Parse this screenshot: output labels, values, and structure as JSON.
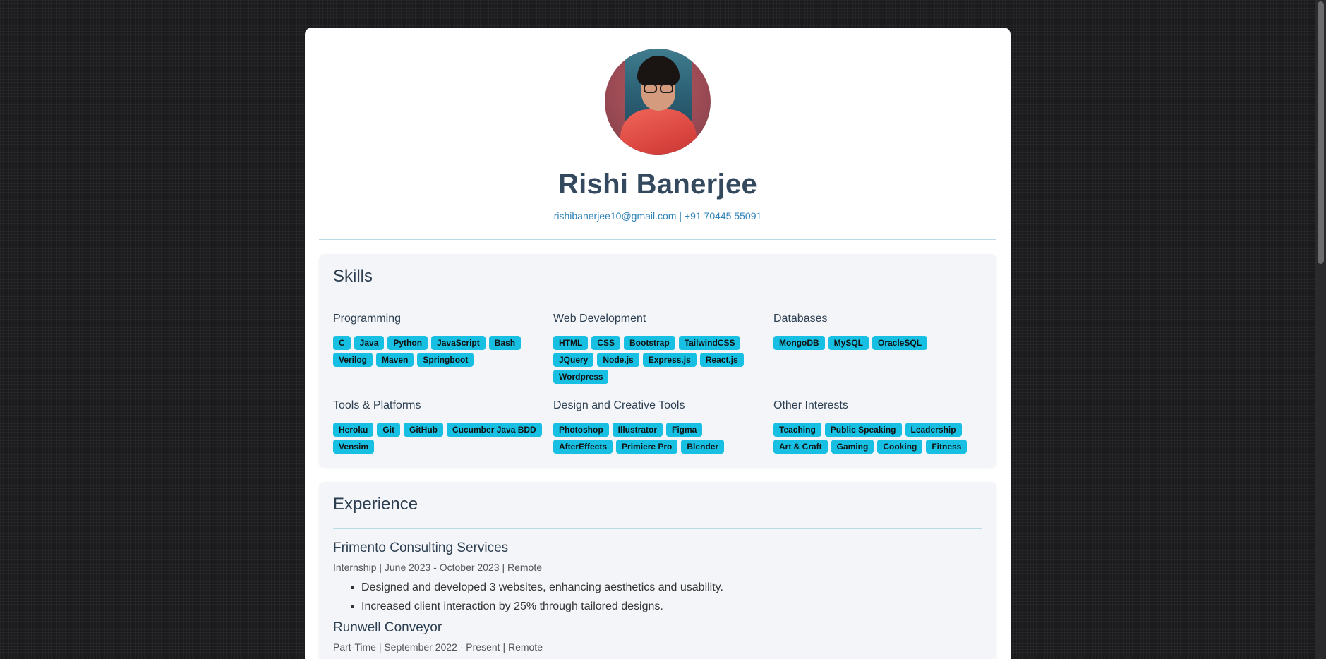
{
  "profile": {
    "name": "Rishi Banerjee",
    "email": "rishibanerjee10@gmail.com",
    "separator": "|",
    "phone": "+91 70445 55091"
  },
  "skills": {
    "heading": "Skills",
    "groups": [
      {
        "title": "Programming",
        "tags": [
          "C",
          "Java",
          "Python",
          "JavaScript",
          "Bash",
          "Verilog",
          "Maven",
          "Springboot"
        ]
      },
      {
        "title": "Web Development",
        "tags": [
          "HTML",
          "CSS",
          "Bootstrap",
          "TailwindCSS",
          "JQuery",
          "Node.js",
          "Express.js",
          "React.js",
          "Wordpress"
        ]
      },
      {
        "title": "Databases",
        "tags": [
          "MongoDB",
          "MySQL",
          "OracleSQL"
        ]
      },
      {
        "title": "Tools & Platforms",
        "tags": [
          "Heroku",
          "Git",
          "GitHub",
          "Cucumber Java BDD",
          "Vensim"
        ]
      },
      {
        "title": "Design and Creative Tools",
        "tags": [
          "Photoshop",
          "Illustrator",
          "Figma",
          "AfterEffects",
          "Primiere Pro",
          "Blender"
        ]
      },
      {
        "title": "Other Interests",
        "tags": [
          "Teaching",
          "Public Speaking",
          "Leadership",
          "Art & Craft",
          "Gaming",
          "Cooking",
          "Fitness"
        ]
      }
    ]
  },
  "experience": {
    "heading": "Experience",
    "jobs": [
      {
        "company": "Frimento Consulting Services",
        "meta": "Internship | June 2023 - October 2023 | Remote",
        "bullets": [
          "Designed and developed 3 websites, enhancing aesthetics and usability.",
          "Increased client interaction by 25% through tailored designs."
        ]
      },
      {
        "company": "Runwell Conveyor",
        "meta": "Part-Time | September 2022 - Present | Remote",
        "bullets": []
      }
    ]
  },
  "colors": {
    "tag_bg": "#17c0e3",
    "link": "#2f82b8",
    "heading": "#34495e"
  }
}
